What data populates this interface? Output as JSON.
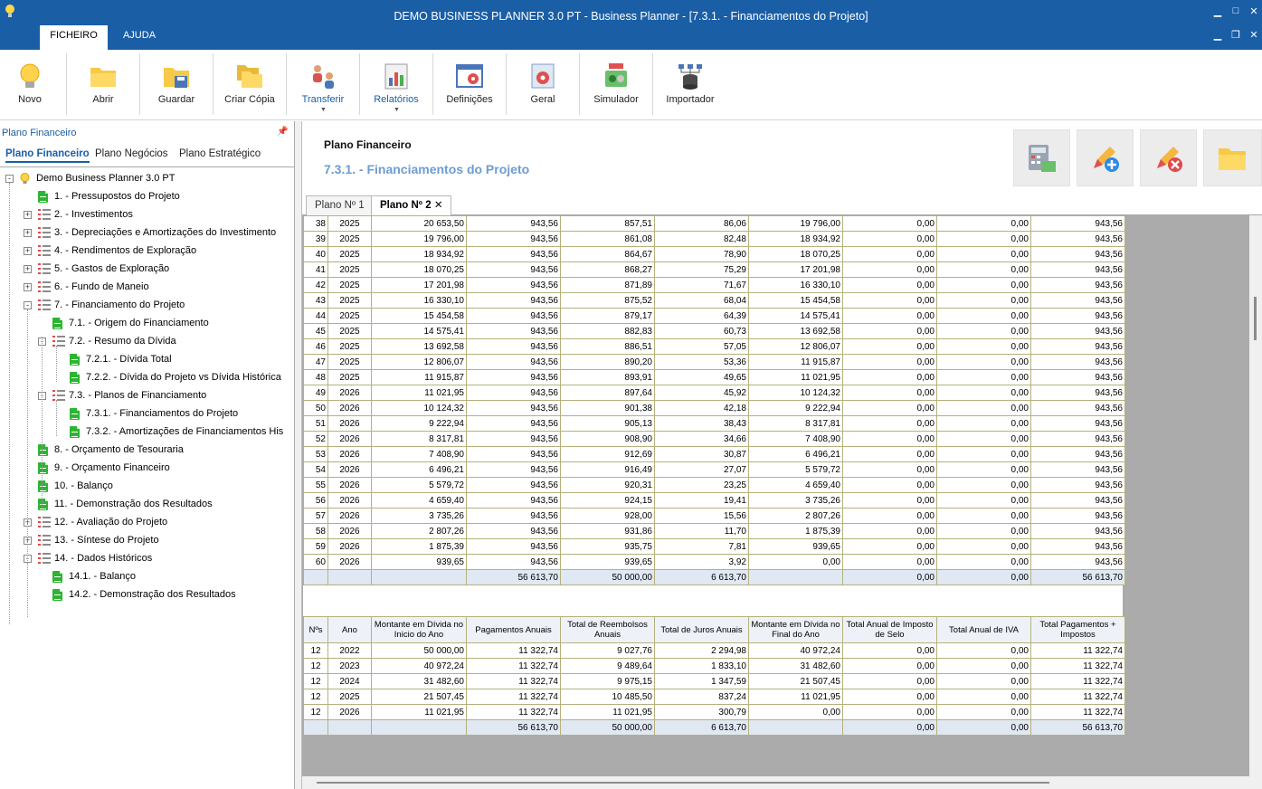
{
  "window": {
    "title": "DEMO BUSINESS PLANNER 3.0 PT - Business Planner - [7.3.1. - Financiamentos do Projeto]",
    "menu_tabs": [
      "FICHEIRO",
      "AJUDA"
    ]
  },
  "ribbon": {
    "buttons": [
      {
        "label": "Novo",
        "icon": "lightbulb-icon"
      },
      {
        "label": "Abrir",
        "icon": "folder-open-icon"
      },
      {
        "label": "Guardar",
        "icon": "folder-save-icon"
      },
      {
        "label": "Criar Cópia",
        "icon": "folder-copy-icon"
      },
      {
        "label": "Transferir",
        "icon": "users-transfer-icon"
      },
      {
        "label": "Relatórios",
        "icon": "reports-chart-icon"
      },
      {
        "label": "Definições",
        "icon": "settings-window-icon"
      },
      {
        "label": "Geral",
        "icon": "gear-window-icon"
      },
      {
        "label": "Simulador",
        "icon": "simulator-icon"
      },
      {
        "label": "Importador",
        "icon": "database-import-icon"
      }
    ]
  },
  "left_panel": {
    "title": "Plano Financeiro",
    "tabs": [
      "Plano Financeiro",
      "Plano Negócios",
      "Plano Estratégico"
    ],
    "tree": [
      {
        "label": "Demo Business Planner 3.0 PT",
        "kind": "root"
      },
      {
        "label": "1. - Pressupostos do Projeto",
        "kind": "doc"
      },
      {
        "label": "2. - Investimentos",
        "kind": "list"
      },
      {
        "label": "3. - Depreciações e Amortizações do Investimento",
        "kind": "list"
      },
      {
        "label": "4. - Rendimentos de Exploração",
        "kind": "list"
      },
      {
        "label": "5. - Gastos de Exploração",
        "kind": "list"
      },
      {
        "label": "6. - Fundo de Maneio",
        "kind": "list"
      },
      {
        "label": "7. - Financiamento do Projeto",
        "kind": "list"
      },
      {
        "label": "7.1. - Origem do Financiamento",
        "kind": "doc"
      },
      {
        "label": "7.2. - Resumo da Dívida",
        "kind": "list"
      },
      {
        "label": "7.2.1. - Dívida Total",
        "kind": "doc"
      },
      {
        "label": "7.2.2. - Dívida do Projeto vs Dívida Histórica",
        "kind": "doc"
      },
      {
        "label": "7.3. - Planos de Financiamento",
        "kind": "list"
      },
      {
        "label": "7.3.1. - Financiamentos do Projeto",
        "kind": "doc"
      },
      {
        "label": "7.3.2. - Amortizações de Financiamentos His",
        "kind": "doc"
      },
      {
        "label": "8. - Orçamento de Tesouraria",
        "kind": "doc"
      },
      {
        "label": "9. - Orçamento Financeiro",
        "kind": "doc"
      },
      {
        "label": "10. - Balanço",
        "kind": "doc"
      },
      {
        "label": "11. - Demonstração dos Resultados",
        "kind": "doc"
      },
      {
        "label": "12. - Avaliação do Projeto",
        "kind": "list"
      },
      {
        "label": "13. - Síntese do Projeto",
        "kind": "list"
      },
      {
        "label": "14. - Dados Históricos",
        "kind": "list"
      },
      {
        "label": "14.1. - Balanço",
        "kind": "doc"
      },
      {
        "label": "14.2. - Demonstração dos Resultados",
        "kind": "doc"
      }
    ]
  },
  "main": {
    "title": "Plano Financeiro",
    "subtitle": "7.3.1. - Financiamentos do Projeto",
    "doc_tabs": [
      "Plano Nº 1",
      "Plano Nº 2"
    ],
    "monthly_rows": [
      [
        "38",
        "2025",
        "20 653,50",
        "943,56",
        "857,51",
        "86,06",
        "19 796,00",
        "0,00",
        "0,00",
        "943,56"
      ],
      [
        "39",
        "2025",
        "19 796,00",
        "943,56",
        "861,08",
        "82,48",
        "18 934,92",
        "0,00",
        "0,00",
        "943,56"
      ],
      [
        "40",
        "2025",
        "18 934,92",
        "943,56",
        "864,67",
        "78,90",
        "18 070,25",
        "0,00",
        "0,00",
        "943,56"
      ],
      [
        "41",
        "2025",
        "18 070,25",
        "943,56",
        "868,27",
        "75,29",
        "17 201,98",
        "0,00",
        "0,00",
        "943,56"
      ],
      [
        "42",
        "2025",
        "17 201,98",
        "943,56",
        "871,89",
        "71,67",
        "16 330,10",
        "0,00",
        "0,00",
        "943,56"
      ],
      [
        "43",
        "2025",
        "16 330,10",
        "943,56",
        "875,52",
        "68,04",
        "15 454,58",
        "0,00",
        "0,00",
        "943,56"
      ],
      [
        "44",
        "2025",
        "15 454,58",
        "943,56",
        "879,17",
        "64,39",
        "14 575,41",
        "0,00",
        "0,00",
        "943,56"
      ],
      [
        "45",
        "2025",
        "14 575,41",
        "943,56",
        "882,83",
        "60,73",
        "13 692,58",
        "0,00",
        "0,00",
        "943,56"
      ],
      [
        "46",
        "2025",
        "13 692,58",
        "943,56",
        "886,51",
        "57,05",
        "12 806,07",
        "0,00",
        "0,00",
        "943,56"
      ],
      [
        "47",
        "2025",
        "12 806,07",
        "943,56",
        "890,20",
        "53,36",
        "11 915,87",
        "0,00",
        "0,00",
        "943,56"
      ],
      [
        "48",
        "2025",
        "11 915,87",
        "943,56",
        "893,91",
        "49,65",
        "11 021,95",
        "0,00",
        "0,00",
        "943,56"
      ],
      [
        "49",
        "2026",
        "11 021,95",
        "943,56",
        "897,64",
        "45,92",
        "10 124,32",
        "0,00",
        "0,00",
        "943,56"
      ],
      [
        "50",
        "2026",
        "10 124,32",
        "943,56",
        "901,38",
        "42,18",
        "9 222,94",
        "0,00",
        "0,00",
        "943,56"
      ],
      [
        "51",
        "2026",
        "9 222,94",
        "943,56",
        "905,13",
        "38,43",
        "8 317,81",
        "0,00",
        "0,00",
        "943,56"
      ],
      [
        "52",
        "2026",
        "8 317,81",
        "943,56",
        "908,90",
        "34,66",
        "7 408,90",
        "0,00",
        "0,00",
        "943,56"
      ],
      [
        "53",
        "2026",
        "7 408,90",
        "943,56",
        "912,69",
        "30,87",
        "6 496,21",
        "0,00",
        "0,00",
        "943,56"
      ],
      [
        "54",
        "2026",
        "6 496,21",
        "943,56",
        "916,49",
        "27,07",
        "5 579,72",
        "0,00",
        "0,00",
        "943,56"
      ],
      [
        "55",
        "2026",
        "5 579,72",
        "943,56",
        "920,31",
        "23,25",
        "4 659,40",
        "0,00",
        "0,00",
        "943,56"
      ],
      [
        "56",
        "2026",
        "4 659,40",
        "943,56",
        "924,15",
        "19,41",
        "3 735,26",
        "0,00",
        "0,00",
        "943,56"
      ],
      [
        "57",
        "2026",
        "3 735,26",
        "943,56",
        "928,00",
        "15,56",
        "2 807,26",
        "0,00",
        "0,00",
        "943,56"
      ],
      [
        "58",
        "2026",
        "2 807,26",
        "943,56",
        "931,86",
        "11,70",
        "1 875,39",
        "0,00",
        "0,00",
        "943,56"
      ],
      [
        "59",
        "2026",
        "1 875,39",
        "943,56",
        "935,75",
        "7,81",
        "939,65",
        "0,00",
        "0,00",
        "943,56"
      ],
      [
        "60",
        "2026",
        "939,65",
        "943,56",
        "939,65",
        "3,92",
        "0,00",
        "0,00",
        "0,00",
        "943,56"
      ]
    ],
    "monthly_total": [
      "",
      "",
      "",
      "56 613,70",
      "50 000,00",
      "6 613,70",
      "",
      "0,00",
      "0,00",
      "56 613,70"
    ],
    "annual_headers": [
      "Nºs",
      "Ano",
      "Montante em Dívida no Inicio do Ano",
      "Pagamentos Anuais",
      "Total de Reembolsos Anuais",
      "Total de Juros Anuais",
      "Montante em Dívida no Final do Ano",
      "Total Anual de Imposto de Selo",
      "Total Anual de IVA",
      "Total Pagamentos + Impostos"
    ],
    "annual_rows": [
      [
        "12",
        "2022",
        "50 000,00",
        "11 322,74",
        "9 027,76",
        "2 294,98",
        "40 972,24",
        "0,00",
        "0,00",
        "11 322,74"
      ],
      [
        "12",
        "2023",
        "40 972,24",
        "11 322,74",
        "9 489,64",
        "1 833,10",
        "31 482,60",
        "0,00",
        "0,00",
        "11 322,74"
      ],
      [
        "12",
        "2024",
        "31 482,60",
        "11 322,74",
        "9 975,15",
        "1 347,59",
        "21 507,45",
        "0,00",
        "0,00",
        "11 322,74"
      ],
      [
        "12",
        "2025",
        "21 507,45",
        "11 322,74",
        "10 485,50",
        "837,24",
        "11 021,95",
        "0,00",
        "0,00",
        "11 322,74"
      ],
      [
        "12",
        "2026",
        "11 021,95",
        "11 322,74",
        "11 021,95",
        "300,79",
        "0,00",
        "0,00",
        "0,00",
        "11 322,74"
      ]
    ],
    "annual_total": [
      "",
      "",
      "",
      "56 613,70",
      "50 000,00",
      "6 613,70",
      "",
      "0,00",
      "0,00",
      "56 613,70"
    ]
  }
}
